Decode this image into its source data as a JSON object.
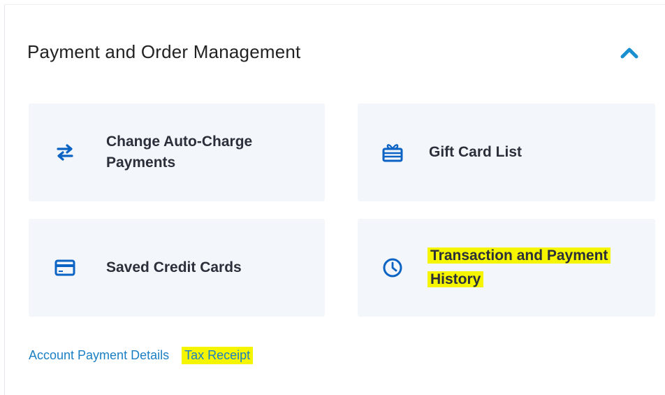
{
  "section": {
    "title": "Payment and Order Management",
    "collapse_icon": "chevron-up-icon"
  },
  "cards": [
    {
      "label_line1": "Change Auto-Charge",
      "label_line2": "Payments",
      "icon": "swap-arrows-icon"
    },
    {
      "label": "Gift Card List",
      "icon": "gift-card-icon"
    },
    {
      "label": "Saved Credit Cards",
      "icon": "credit-card-icon"
    },
    {
      "label_line1": "Transaction and Payment",
      "label_line2": "History",
      "icon": "clock-icon",
      "highlighted": true
    }
  ],
  "links": [
    {
      "label": "Account Payment Details"
    },
    {
      "label": "Tax Receipt",
      "highlighted": true
    }
  ],
  "colors": {
    "accent": "#1a7fc4",
    "icon_blue": "#0b63c4",
    "card_bg": "#f3f6fa",
    "highlight": "#f5f500"
  }
}
